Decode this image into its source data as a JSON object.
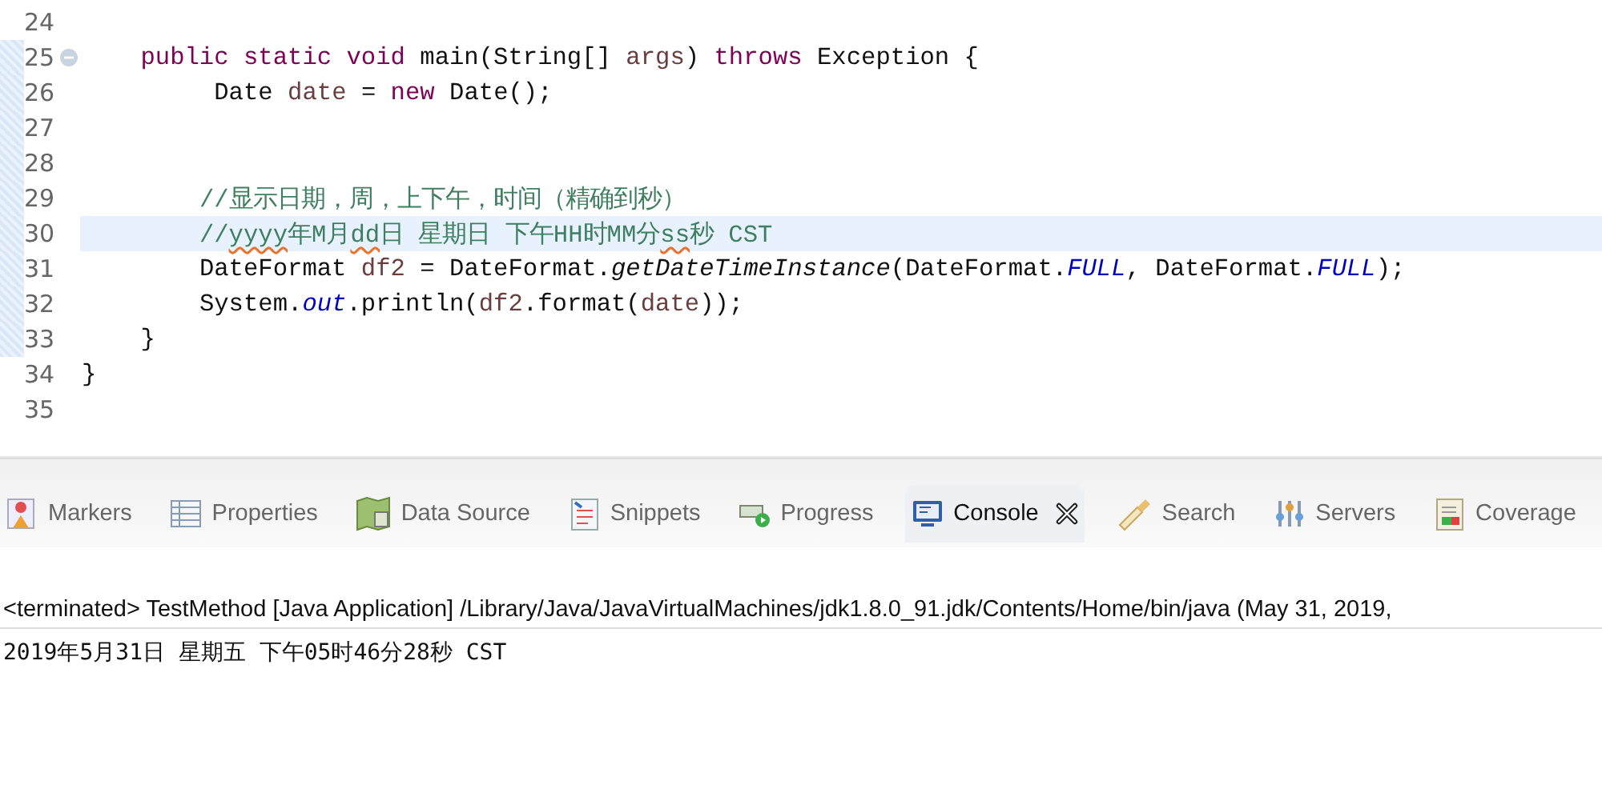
{
  "editor": {
    "lines": [
      {
        "number": "24",
        "highlighted": false,
        "in_range": false,
        "foldable": false
      },
      {
        "number": "25",
        "highlighted": false,
        "in_range": true,
        "foldable": true,
        "tokens": [
          {
            "text": "    public static void",
            "kind": "keyword"
          },
          {
            "text": " main(String[] ",
            "kind": "plain"
          },
          {
            "text": "args",
            "kind": "variable"
          },
          {
            "text": ") ",
            "kind": "plain"
          },
          {
            "text": "throws",
            "kind": "keyword"
          },
          {
            "text": " Exception {",
            "kind": "plain"
          }
        ]
      },
      {
        "number": "26",
        "highlighted": false,
        "in_range": true,
        "foldable": false,
        "tokens": [
          {
            "text": "         Date ",
            "kind": "plain"
          },
          {
            "text": "date",
            "kind": "variable"
          },
          {
            "text": " = ",
            "kind": "plain"
          },
          {
            "text": "new",
            "kind": "keyword"
          },
          {
            "text": " Date();",
            "kind": "plain"
          }
        ]
      },
      {
        "number": "27",
        "highlighted": false,
        "in_range": true,
        "foldable": false
      },
      {
        "number": "28",
        "highlighted": false,
        "in_range": true,
        "foldable": false
      },
      {
        "number": "29",
        "highlighted": false,
        "in_range": true,
        "foldable": false,
        "tokens": [
          {
            "text": "        //显示日期，周，上下午，时间（精确到秒）",
            "kind": "comment"
          }
        ]
      },
      {
        "number": "30",
        "highlighted": true,
        "in_range": true,
        "foldable": false,
        "tokens": [
          {
            "text": "        //",
            "kind": "comment"
          },
          {
            "text": "yyyy",
            "kind": "comment_warning"
          },
          {
            "text": "年M月",
            "kind": "comment"
          },
          {
            "text": "dd",
            "kind": "comment_warning"
          },
          {
            "text": "日 星期日 下午HH时MM分",
            "kind": "comment"
          },
          {
            "text": "ss",
            "kind": "comment_warning"
          },
          {
            "text": "秒 CST",
            "kind": "comment"
          }
        ]
      },
      {
        "number": "31",
        "highlighted": false,
        "in_range": true,
        "foldable": false,
        "tokens": [
          {
            "text": "        DateFormat ",
            "kind": "plain"
          },
          {
            "text": "df2",
            "kind": "variable"
          },
          {
            "text": " = DateFormat.",
            "kind": "plain"
          },
          {
            "text": "getDateTimeInstance",
            "kind": "static_method"
          },
          {
            "text": "(DateFormat.",
            "kind": "plain"
          },
          {
            "text": "FULL",
            "kind": "static_field"
          },
          {
            "text": ", DateFormat.",
            "kind": "plain"
          },
          {
            "text": "FULL",
            "kind": "static_field"
          },
          {
            "text": ");",
            "kind": "plain"
          }
        ]
      },
      {
        "number": "32",
        "highlighted": false,
        "in_range": true,
        "foldable": false,
        "tokens": [
          {
            "text": "        System.",
            "kind": "plain"
          },
          {
            "text": "out",
            "kind": "static_field"
          },
          {
            "text": ".println(",
            "kind": "plain"
          },
          {
            "text": "df2",
            "kind": "variable"
          },
          {
            "text": ".format(",
            "kind": "plain"
          },
          {
            "text": "date",
            "kind": "variable"
          },
          {
            "text": "));",
            "kind": "plain"
          }
        ]
      },
      {
        "number": "33",
        "highlighted": false,
        "in_range": true,
        "foldable": false,
        "tokens": [
          {
            "text": "    }",
            "kind": "plain"
          }
        ]
      },
      {
        "number": "34",
        "highlighted": false,
        "in_range": false,
        "foldable": false,
        "tokens": [
          {
            "text": "}",
            "kind": "plain"
          }
        ]
      },
      {
        "number": "35",
        "highlighted": false,
        "in_range": false,
        "foldable": false
      }
    ]
  },
  "panel": {
    "tabs": [
      {
        "label": "Markers",
        "selected": false
      },
      {
        "label": "Properties",
        "selected": false
      },
      {
        "label": "Data Source",
        "selected": false
      },
      {
        "label": "Snippets",
        "selected": false
      },
      {
        "label": "Progress",
        "selected": false
      },
      {
        "label": "Console",
        "selected": true
      },
      {
        "label": "Search",
        "selected": false
      },
      {
        "label": "Servers",
        "selected": false
      },
      {
        "label": "Coverage",
        "selected": false
      }
    ]
  },
  "console": {
    "header": "<terminated> TestMethod [Java Application] /Library/Java/JavaVirtualMachines/jdk1.8.0_91.jdk/Contents/Home/bin/java (May 31, 2019,",
    "output": [
      "2019年5月31日 星期五 下午05时46分28秒 CST"
    ]
  }
}
